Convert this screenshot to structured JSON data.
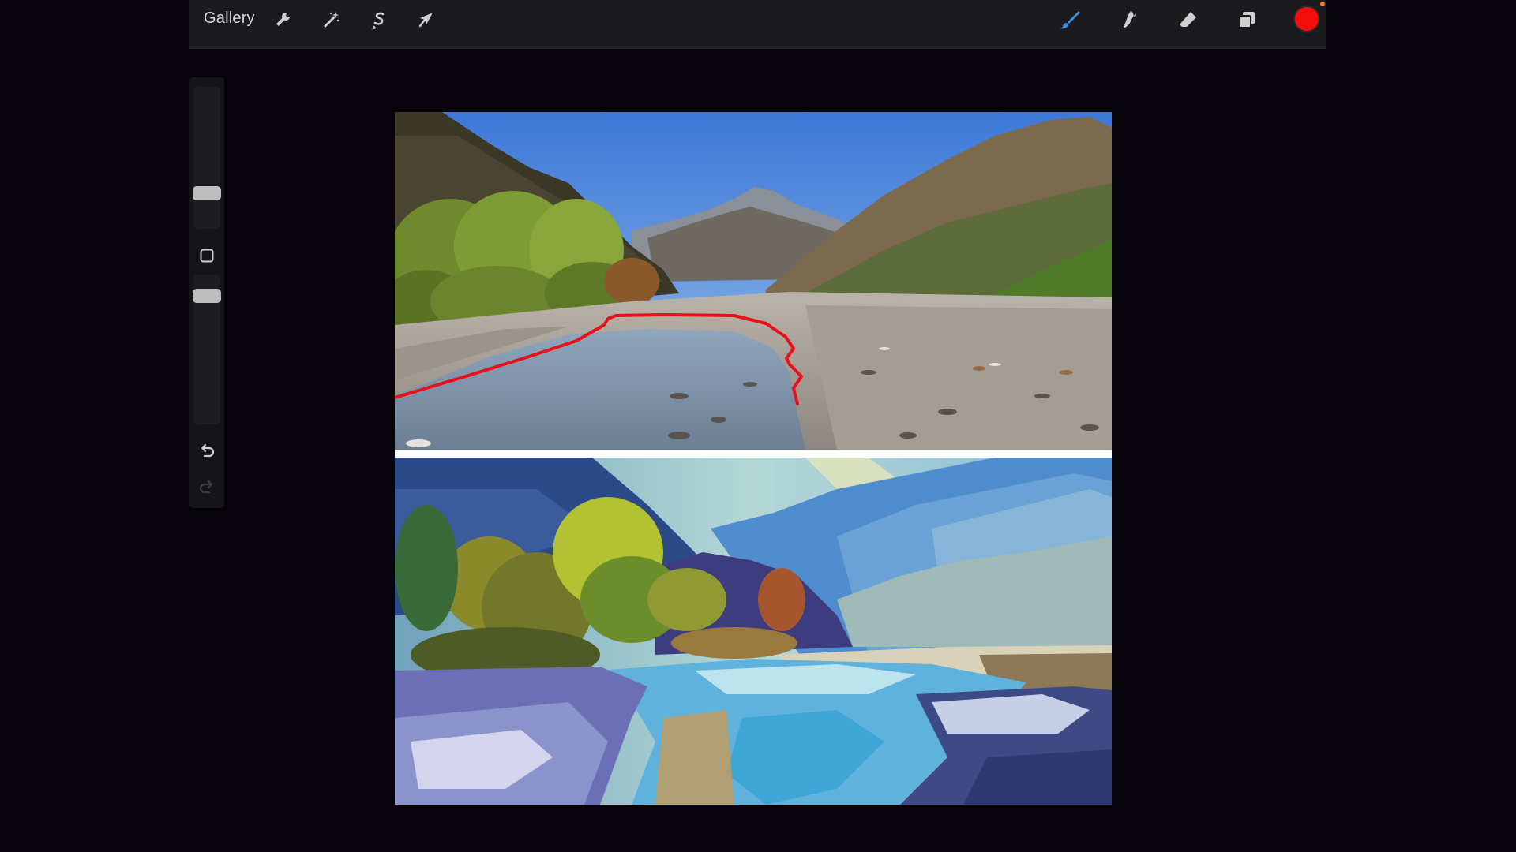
{
  "topbar": {
    "gallery_label": "Gallery",
    "actions_icon": "wrench-icon",
    "adjustments_icon": "magic-wand-icon",
    "selection_icon": "selection-s-icon",
    "transform_icon": "arrow-cursor-icon",
    "brush_icon": "brush-icon",
    "smudge_icon": "smudge-icon",
    "eraser_icon": "eraser-icon",
    "layers_icon": "layers-icon",
    "active_color": "#f30d0d"
  },
  "sidebar": {
    "modify_icon": "square-modify-icon",
    "undo_icon": "undo-icon",
    "redo_icon": "redo-icon"
  },
  "canvas": {
    "annotation_color": "#e8101a"
  }
}
